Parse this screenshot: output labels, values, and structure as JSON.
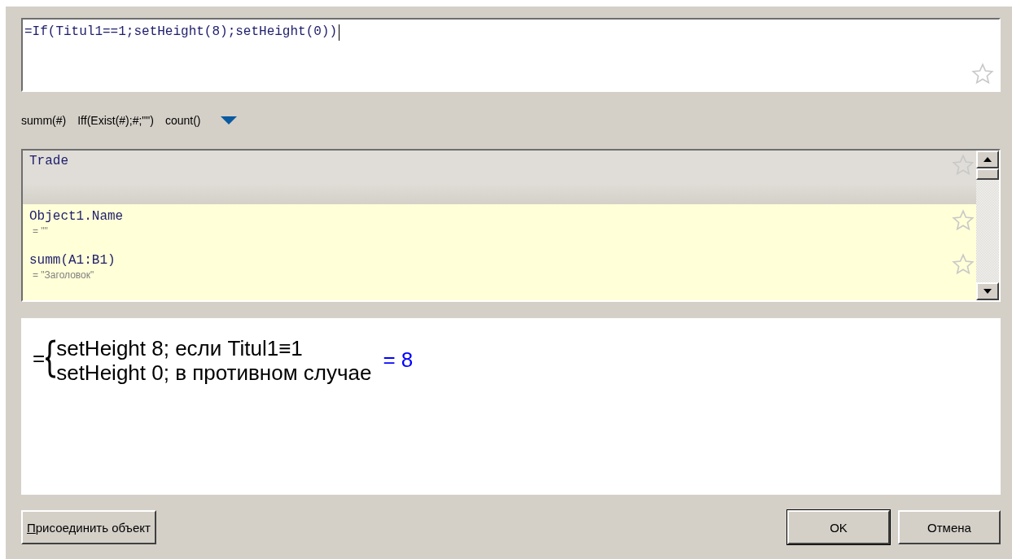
{
  "formula": {
    "value": "=If(Titul1==1;setHeight(8);setHeight(0))",
    "focused": true
  },
  "snippets": [
    "summ(#)",
    "Iff(Exist(#);#;\"\")",
    "count()"
  ],
  "list": [
    {
      "kind": "group",
      "name": "Trade"
    },
    {
      "kind": "item",
      "name": "Object1.Name",
      "value": "= \"\""
    },
    {
      "kind": "item",
      "name": "summ(A1:B1)",
      "value": "= \"Заголовок\""
    }
  ],
  "preview": {
    "prefix": "=",
    "cases": [
      "setHeight 8; если Titul1≡1",
      "setHeight 0; в противном случае"
    ],
    "result": "= 8"
  },
  "buttons": {
    "left": "Присоединить объект",
    "ok": "OK",
    "cancel": "Отмена"
  }
}
